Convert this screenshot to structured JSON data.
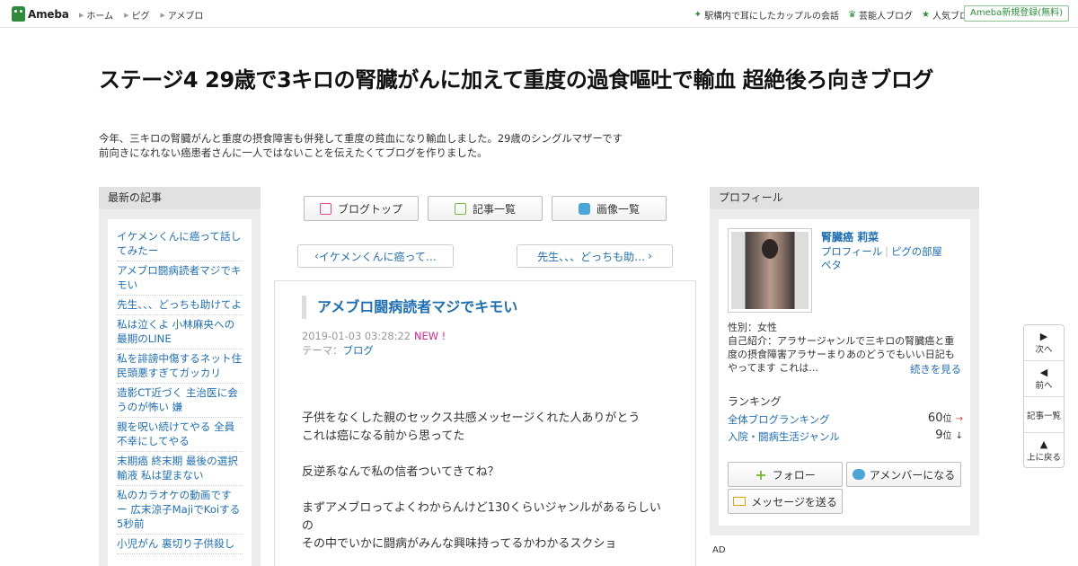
{
  "topbar": {
    "logo": "Ameba",
    "crumbs": [
      "ホーム",
      "ピグ",
      "アメブロ"
    ],
    "links": [
      {
        "label": "駅構内で耳にしたカップルの会話",
        "icon": "sparkle-icon"
      },
      {
        "label": "芸能人ブログ",
        "icon": "crown-icon"
      },
      {
        "label": "人気ブログ",
        "icon": "star-icon"
      }
    ],
    "signup": "Ameba新規登録(無料)"
  },
  "blog": {
    "title": "ステージ4 29歳で3キロの腎臓がんに加えて重度の過食嘔吐で輸血 超絶後ろ向きブログ",
    "desc1": "今年、三キロの腎臓がんと重度の摂食障害も併発して重度の貧血になり輸血しました。29歳のシングルマザーです",
    "desc2": "前向きになれない癌患者さんに一人ではないことを伝えたくてブログを作りました。"
  },
  "left": {
    "heading": "最新の記事",
    "recent": [
      "イケメンくんに癌って話してみたー",
      "アメブロ闘病読者マジでキモい",
      "先生、、、どっちも助けてよ",
      "私は泣くよ 小林麻央への最期のLINE",
      "私を誹謗中傷するネット住民頭悪すぎてガッカリ",
      "造影CT近づく 主治医に会うのが怖い 嫌",
      "親を呪い続けてやる 全員不幸にしてやる",
      "末期癌 終末期 最後の選択 輸液 私は望まない",
      "私のカラオケの動画です ー 広末涼子MajiでKoiする5秒前",
      "小児がん 裏切り子供殺し"
    ]
  },
  "nav": {
    "top": "ブログトップ",
    "list": "記事一覧",
    "images": "画像一覧"
  },
  "pager": {
    "prev": "イケメンくんに癌って…",
    "next": "先生、、、どっちも助…"
  },
  "article": {
    "title": "アメブロ闘病読者マジでキモい",
    "date": "2019-01-03 03:28:22",
    "new_label": "NEW !",
    "theme_label": "テーマ：",
    "theme": "ブログ",
    "lines": [
      "子供をなくした親のセックス共感メッセージくれた人ありがとう",
      "これは癌になる前から思ってた",
      "",
      "反逆系なんで私の信者ついてきてね？",
      "",
      "まずアメブロってよくわからんけど130くらいジャンルがあるらしいの",
      "その中でいかに闘病がみんな興味持ってるかわかるスクショ"
    ]
  },
  "profile": {
    "heading": "プロフィール",
    "name": "腎臓癌 莉菜",
    "link1": "プロフィール",
    "link2": "ピグの部屋",
    "link3": "ペタ",
    "gender": "性別：女性",
    "intro": "自己紹介：アラサージャンルで三キロの腎臓癌と重度の摂食障害アラサーまりあのどうでもいい日記もやってます これは...",
    "more": "続きを見る",
    "ranking_head": "ランキング",
    "rank1_label": "全体ブログランキング",
    "rank1_value": "60",
    "rank1_unit": "位",
    "rank1_arrow": "→",
    "rank2_label": "入院・闘病生活ジャンル",
    "rank2_value": "9",
    "rank2_unit": "位",
    "rank2_arrow": "↓",
    "follow": "フォロー",
    "amember": "アメンバーになる",
    "message": "メッセージを送る"
  },
  "ad_label": "AD",
  "float_nav": {
    "next": "次へ",
    "prev": "前へ",
    "list": "記事一覧",
    "top": "上に戻る"
  },
  "colors": {
    "accent": "#1f6fb5",
    "brand": "#2d8c3c",
    "new": "#e0248b"
  }
}
